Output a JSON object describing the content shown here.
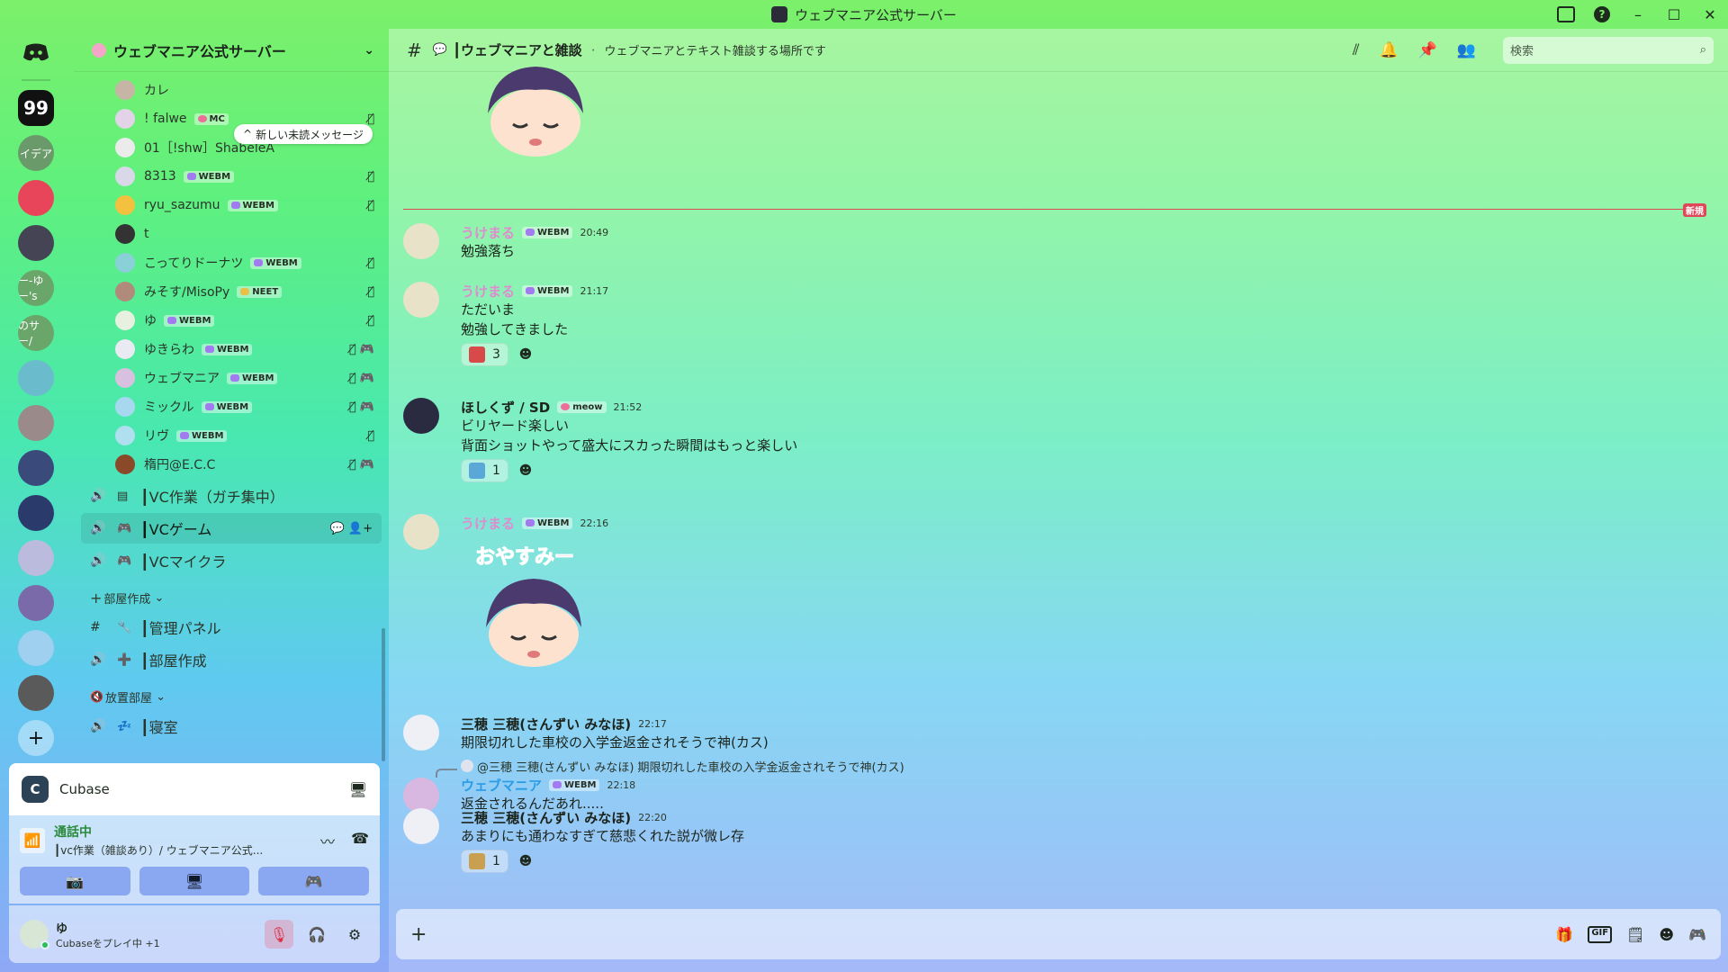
{
  "window": {
    "title": "ウェブマニア公式サーバー",
    "min": "–",
    "max": "☐",
    "close": "✕",
    "help": "?"
  },
  "rail": {
    "servers": [
      {
        "name": "quotes",
        "label": "99",
        "color": "#111111"
      },
      {
        "name": "idea",
        "label": "イデア",
        "color": "#6a9a6a"
      },
      {
        "name": "discord",
        "label": "",
        "color": "#e8445a"
      },
      {
        "name": "server-4",
        "label": "",
        "color": "#444455"
      },
      {
        "name": "server-5",
        "label": "ー-ゆー's",
        "color": "#6aa56a"
      },
      {
        "name": "server-6",
        "label": "のサー/",
        "color": "#6aa56a"
      },
      {
        "name": "server-7",
        "label": "",
        "color": "#6abccc"
      },
      {
        "name": "server-8",
        "label": "",
        "color": "#9a8a8a"
      },
      {
        "name": "server-9",
        "label": "",
        "color": "#3a4a7a"
      },
      {
        "name": "server-10",
        "label": "",
        "color": "#2a3a6a"
      },
      {
        "name": "server-11",
        "label": "",
        "color": "#bbbbdd"
      },
      {
        "name": "server-12",
        "label": "",
        "color": "#7a6aaa"
      },
      {
        "name": "server-13",
        "label": "",
        "color": "#a0d0f0"
      },
      {
        "name": "server-14",
        "label": "",
        "color": "#5a5a5a"
      }
    ]
  },
  "sidebar": {
    "guild_name": "ウェブマニア公式サーバー",
    "unread_label": "新しい未読メッセージ",
    "members": [
      {
        "name": "カレ",
        "tag": "",
        "tag_type": "",
        "status": "",
        "color": "#c6b4a4"
      },
      {
        "name": "! falwe",
        "tag": "MC",
        "tag_type": "meow",
        "status": "🎙̸",
        "color": "#e3d3e8"
      },
      {
        "name": "01［!shw］ShabeleA",
        "tag": "",
        "tag_type": "",
        "status": "",
        "color": "#ebebeb"
      },
      {
        "name": "8313",
        "tag": "WEBM",
        "tag_type": "webm",
        "status": "🎙̸",
        "color": "#d8d8e8"
      },
      {
        "name": "ryu_sazumu",
        "tag": "WEBM",
        "tag_type": "webm",
        "status": "🎙̸",
        "color": "#f3c040"
      },
      {
        "name": "t",
        "tag": "",
        "tag_type": "",
        "status": "",
        "color": "#333333"
      },
      {
        "name": "こってりドーナツ",
        "tag": "WEBM",
        "tag_type": "webm",
        "status": "🎙̸",
        "color": "#8ad0d8"
      },
      {
        "name": "みそす/MisoPy",
        "tag": "NEET",
        "tag_type": "neet",
        "status": "🎙̸",
        "color": "#b08a7a"
      },
      {
        "name": "ゆ",
        "tag": "WEBM",
        "tag_type": "webm",
        "status": "🎙̸",
        "color": "#e8f0e0"
      },
      {
        "name": "ゆきらわ",
        "tag": "WEBM",
        "tag_type": "webm",
        "status": "🎙̸ 🎮",
        "color": "#eaeaf2"
      },
      {
        "name": "ウェブマニア",
        "tag": "WEBM",
        "tag_type": "webm",
        "status": "🎙̸ 🎮",
        "color": "#d8c0e0"
      },
      {
        "name": "ミックル",
        "tag": "WEBM",
        "tag_type": "webm",
        "status": "🎙̸ 🎮",
        "color": "#a8d8f0"
      },
      {
        "name": "リヴ",
        "tag": "WEBM",
        "tag_type": "webm",
        "status": "🎙̸",
        "color": "#b0e0f0"
      },
      {
        "name": "楕円@E.C.C",
        "tag": "",
        "tag_type": "",
        "status": "🎙̸ 🎮",
        "color": "#8a4a2a"
      }
    ],
    "voice_channels": [
      {
        "icon": "🔊",
        "sub": "▤",
        "name": "┃VC作業（ガチ集中）",
        "right": ""
      },
      {
        "icon": "🔊",
        "sub": "🎮",
        "name": "┃VCゲーム",
        "right": "💬 👤+"
      },
      {
        "icon": "🔊",
        "sub": "🎮",
        "name": "┃VCマイクラ",
        "right": ""
      }
    ],
    "cat1": "部屋作成",
    "cat1_channels": [
      {
        "icon": "#",
        "sub": "🔧",
        "name": "┃管理パネル"
      },
      {
        "icon": "🔊",
        "sub": "➕",
        "name": "┃部屋作成"
      }
    ],
    "cat2": "放置部屋",
    "cat2_channels": [
      {
        "icon": "🔊",
        "sub": "💤",
        "name": "┃寝室"
      }
    ]
  },
  "activity": {
    "app": "Cubase"
  },
  "voice": {
    "status": "通話中",
    "channel": "┃vc作業（雑談あり）/ ウェブマニア公式..."
  },
  "user": {
    "name": "ゆ",
    "status": "Cubaseをプレイ中 +1"
  },
  "channel": {
    "name": "┃ウェブマニアと雑談",
    "topic": "ウェブマニアとテキスト雑談する場所です",
    "search_placeholder": "検索",
    "new_label": "新規"
  },
  "messages": [
    {
      "id": "m1",
      "user": "うけまる",
      "tag": "WEBM",
      "time": "20:49",
      "lines": [
        "勉強落ち"
      ],
      "color": "pink"
    },
    {
      "id": "m2",
      "user": "うけまる",
      "tag": "WEBM",
      "time": "21:17",
      "lines": [
        "ただいま",
        "勉強してきました"
      ],
      "color": "pink",
      "react_count": "3"
    },
    {
      "id": "m3",
      "user": "ほしくず / SD",
      "tag": "meow",
      "time": "21:52",
      "lines": [
        "ビリヤード楽しい",
        "背面ショットやって盛大にスカった瞬間はもっと楽しい"
      ],
      "color": "",
      "react_count": "1"
    },
    {
      "id": "m4",
      "user": "うけまる",
      "tag": "WEBM",
      "time": "22:16",
      "sticker_text": "おやすみー",
      "color": "pink"
    },
    {
      "id": "m5",
      "user": "三穂 三穂(さんずい みなほ)",
      "tag": "",
      "time": "22:17",
      "lines": [
        "期限切れした車校の入学金返金されそうで神(カス)"
      ],
      "color": ""
    },
    {
      "id": "m6",
      "user": "ウェブマニア",
      "tag": "WEBM",
      "time": "22:18",
      "reply": "@三穂 三穂(さんずい みなほ) 期限切れした車校の入学金返金されそうで神(カス)",
      "lines": [
        "返金されるんだあれ....."
      ],
      "color": "blue"
    },
    {
      "id": "m7",
      "user": "三穂 三穂(さんずい みなほ)",
      "tag": "",
      "time": "22:20",
      "lines": [
        "あまりにも通わなすぎて慈悲くれた説が微レ存"
      ],
      "color": "",
      "react_count": "1"
    }
  ]
}
